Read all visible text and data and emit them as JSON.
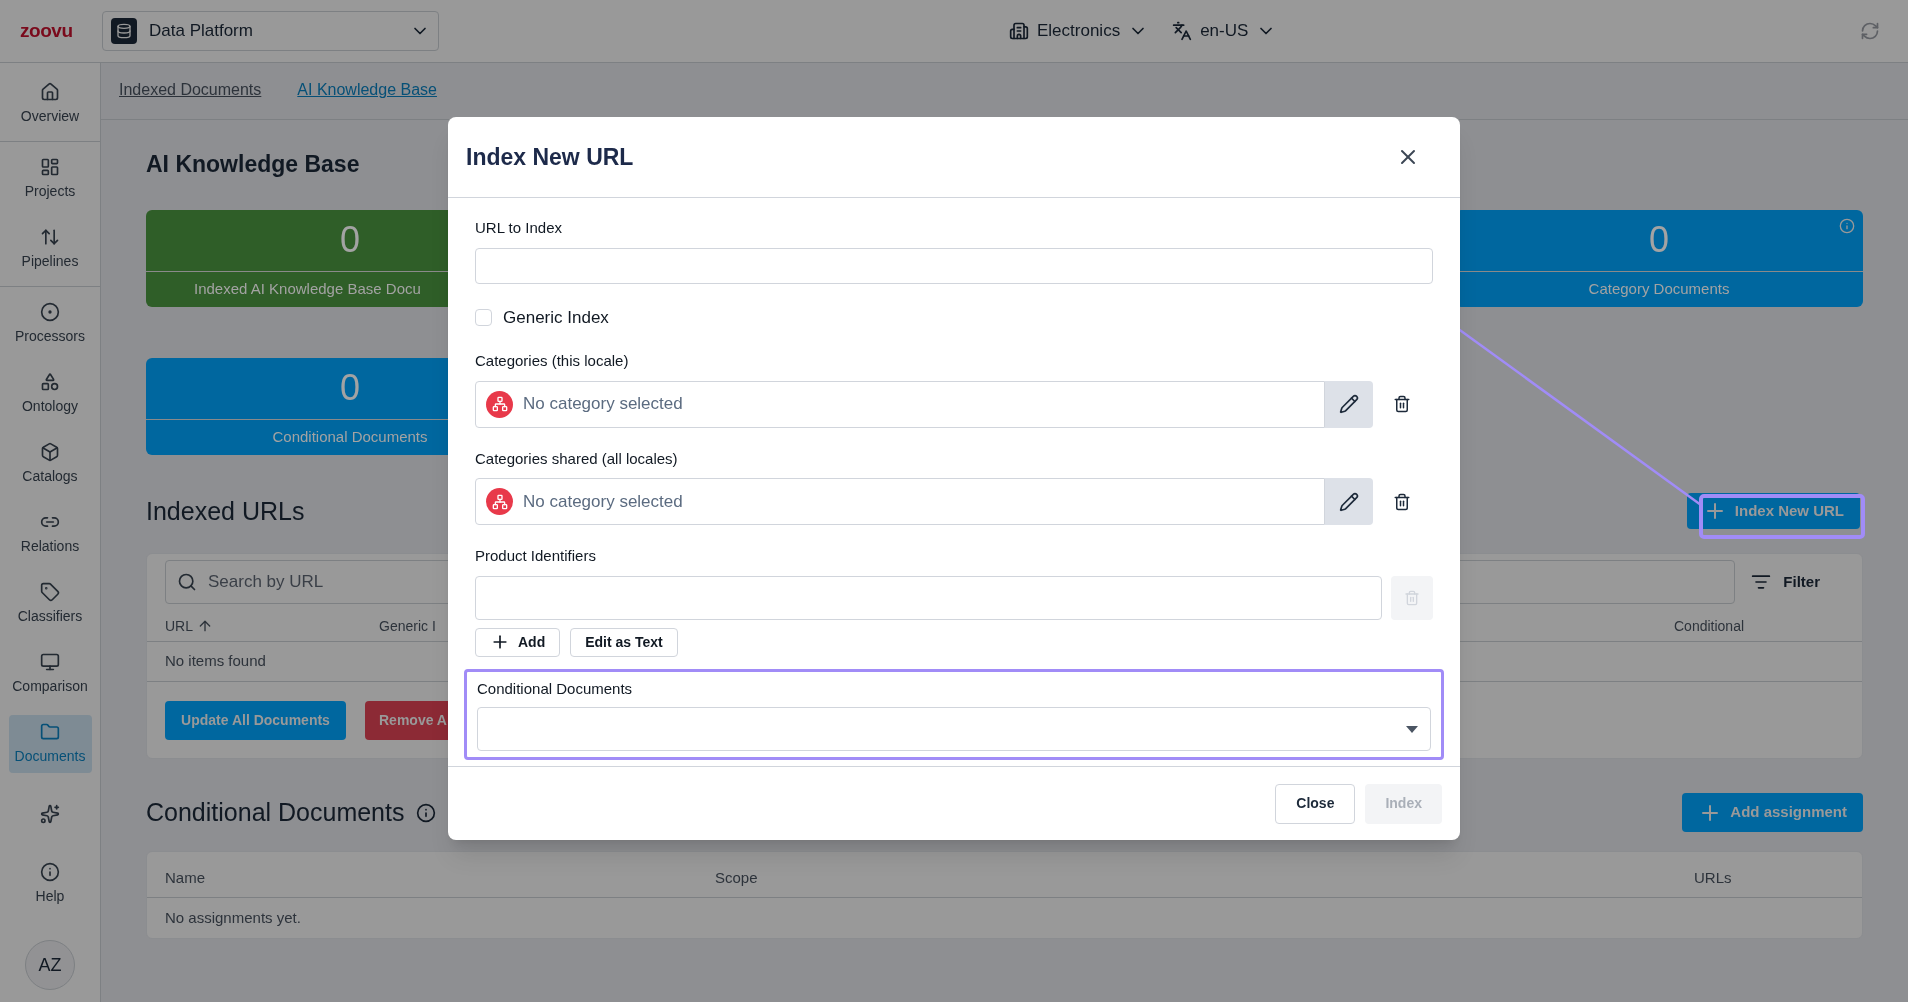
{
  "top_bar": {
    "brand": "zoovu",
    "project": "Data Platform",
    "catalog": "Electronics",
    "locale": "en-US"
  },
  "sidebar": {
    "groups": [
      [
        {
          "label": "Overview",
          "selected": false
        }
      ],
      [
        {
          "label": "Projects",
          "selected": false
        },
        {
          "label": "Pipelines",
          "selected": false
        }
      ],
      [
        {
          "label": "Processors",
          "selected": false
        },
        {
          "label": "Ontology",
          "selected": false
        },
        {
          "label": "Catalogs",
          "selected": false
        },
        {
          "label": "Relations",
          "selected": false
        },
        {
          "label": "Classifiers",
          "selected": false
        },
        {
          "label": "Comparison",
          "selected": false
        },
        {
          "label": "Documents",
          "selected": true
        },
        {
          "selected": false
        },
        {
          "label": "Help",
          "selected": false
        }
      ]
    ],
    "avatar": "AZ"
  },
  "tabs": [
    {
      "label": "Indexed Documents",
      "selected": false
    },
    {
      "label": "AI Knowledge Base",
      "selected": true
    }
  ],
  "page": {
    "title": "AI Knowledge Base",
    "stat_rows": [
      [
        {
          "value": "0",
          "label": "Indexed AI Knowledge Base Docu",
          "color": "#2f5e28",
          "info": false
        },
        {
          "value": "0",
          "label": "Category Documents",
          "color": "#00679f",
          "info": true
        }
      ],
      [
        {
          "value": "0",
          "label": "Conditional Documents",
          "color": "#00679f",
          "info": false
        }
      ]
    ],
    "indexed_urls": {
      "title": "Indexed URLs",
      "action": {
        "label": "Index New URL",
        "highlighted": true
      },
      "search_placeholder": "Search by URL",
      "filter": "Filter",
      "columns": [
        {
          "label": "URL",
          "sorted": true
        },
        {
          "label": "Generic I",
          "sorted": false
        },
        {
          "label": "Conditional",
          "sorted": false
        }
      ],
      "empty": "No items found",
      "buttons": [
        {
          "label": "Update All Documents",
          "kind": "primary"
        },
        {
          "label": "Remove A",
          "kind": "danger"
        }
      ]
    },
    "conditional": {
      "title": "Conditional Documents",
      "action": "Add assignment",
      "columns": [
        "Name",
        "Scope",
        "URLs"
      ],
      "empty": "No assignments yet."
    }
  },
  "modal": {
    "title": "Index New URL",
    "url_label": "URL to Index",
    "generic_index": {
      "label": "Generic Index",
      "checked": false
    },
    "category_fields": [
      {
        "label": "Categories (this locale)",
        "value": "No category selected"
      },
      {
        "label": "Categories shared (all locales)",
        "value": "No category selected"
      }
    ],
    "product_identifiers": {
      "label": "Product Identifiers",
      "add": "Add",
      "edit_as_text": "Edit as Text"
    },
    "conditional_documents": {
      "label": "Conditional Documents",
      "highlighted": true
    },
    "buttons": [
      {
        "label": "Close",
        "disabled": false
      },
      {
        "label": "Index",
        "disabled": true
      }
    ]
  },
  "annotation": {
    "arrow": true
  }
}
